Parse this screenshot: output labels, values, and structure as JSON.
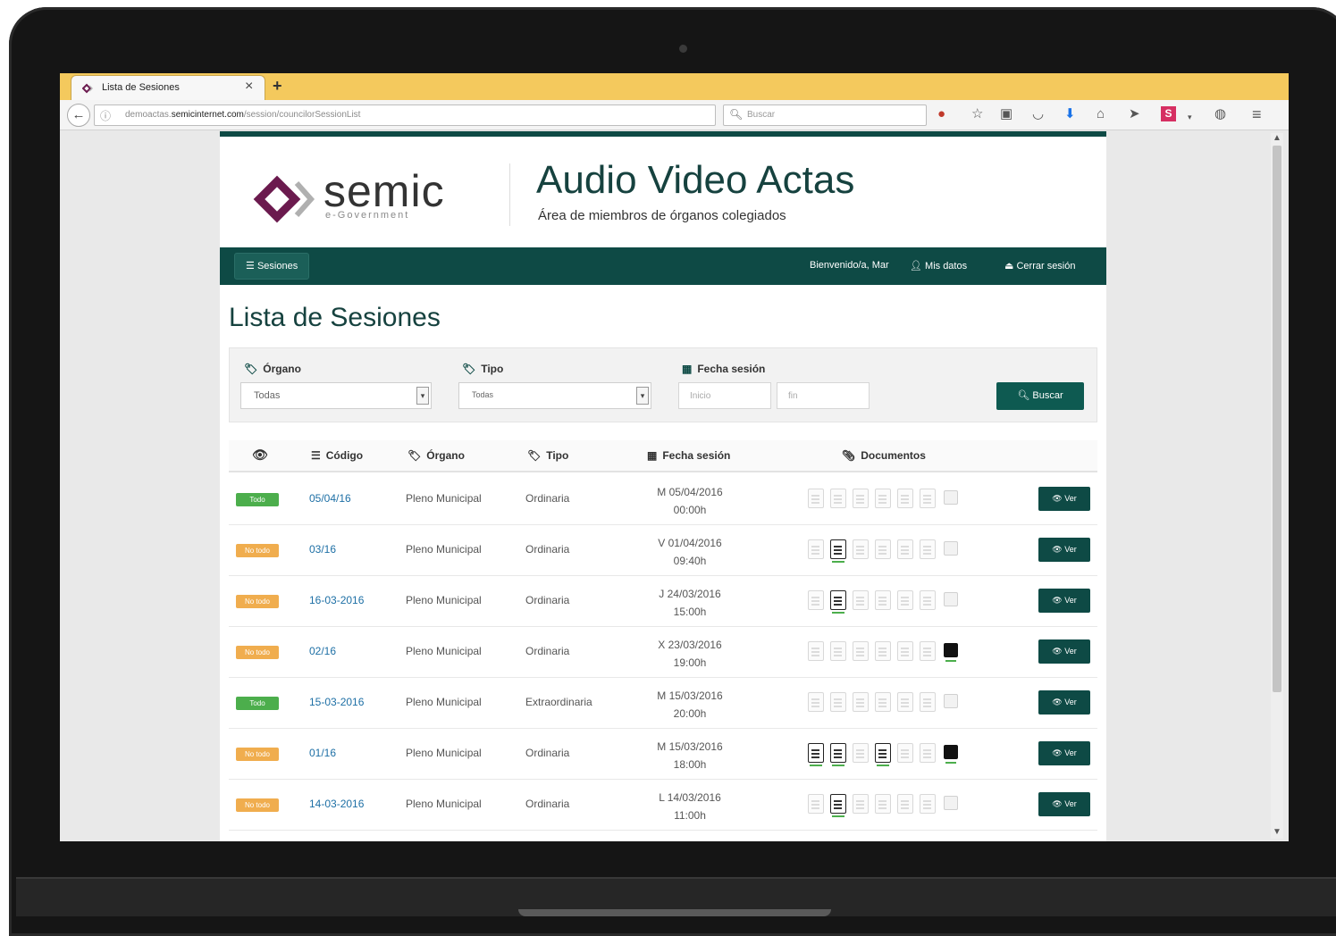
{
  "browser": {
    "tab_title": "Lista de Sesiones",
    "new_tab": "+",
    "url_prefix": "demoactas.",
    "url_domain": "semicinternet.com",
    "url_path": "/session/councilorSessionList",
    "search_placeholder": "Buscar"
  },
  "header": {
    "logo_text": "semic",
    "logo_sub": "e-Government",
    "app_title": "Audio Video Actas",
    "app_subtitle": "Área de miembros de órganos colegiados"
  },
  "nav": {
    "sesiones": "Sesiones",
    "welcome": "Bienvenido/a, Mar",
    "mis_datos": "Mis datos",
    "cerrar_sesion": "Cerrar sesión"
  },
  "page_title": "Lista de Sesiones",
  "filters": {
    "organo_label": "Órgano",
    "organo_value": "Todas",
    "tipo_label": "Tipo",
    "tipo_value": "Todas",
    "fecha_label": "Fecha sesión",
    "inicio_placeholder": "Inicio",
    "fin_placeholder": "fin",
    "buscar_label": "Buscar"
  },
  "table": {
    "headers": {
      "codigo": "Código",
      "organo": "Órgano",
      "tipo": "Tipo",
      "fecha": "Fecha sesión",
      "documentos": "Documentos"
    },
    "ver_label": "Ver",
    "rows": [
      {
        "status": "Todo",
        "status_color": "#4cae4c",
        "code": "05/04/16",
        "organo": "Pleno Municipal",
        "tipo": "Ordinaria",
        "date": "M 05/04/2016",
        "time": "00:00h",
        "docs": [
          0,
          0,
          0,
          0,
          0,
          0
        ],
        "video": 0
      },
      {
        "status": "No todo",
        "status_color": "#f0ad4e",
        "code": "03/16",
        "organo": "Pleno Municipal",
        "tipo": "Ordinaria",
        "date": "V 01/04/2016",
        "time": "09:40h",
        "docs": [
          0,
          1,
          0,
          0,
          0,
          0
        ],
        "video": 0
      },
      {
        "status": "No todo",
        "status_color": "#f0ad4e",
        "code": "16-03-2016",
        "organo": "Pleno Municipal",
        "tipo": "Ordinaria",
        "date": "J 24/03/2016",
        "time": "15:00h",
        "docs": [
          0,
          1,
          0,
          0,
          0,
          0
        ],
        "video": 0
      },
      {
        "status": "No todo",
        "status_color": "#f0ad4e",
        "code": "02/16",
        "organo": "Pleno Municipal",
        "tipo": "Ordinaria",
        "date": "X 23/03/2016",
        "time": "19:00h",
        "docs": [
          0,
          0,
          0,
          0,
          0,
          0
        ],
        "video": 1
      },
      {
        "status": "Todo",
        "status_color": "#4cae4c",
        "code": "15-03-2016",
        "organo": "Pleno Municipal",
        "tipo": "Extraordinaria",
        "date": "M 15/03/2016",
        "time": "20:00h",
        "docs": [
          0,
          0,
          0,
          0,
          0,
          0
        ],
        "video": 0
      },
      {
        "status": "No todo",
        "status_color": "#f0ad4e",
        "code": "01/16",
        "organo": "Pleno Municipal",
        "tipo": "Ordinaria",
        "date": "M 15/03/2016",
        "time": "18:00h",
        "docs": [
          1,
          1,
          0,
          1,
          0,
          0
        ],
        "video": 1
      },
      {
        "status": "No todo",
        "status_color": "#f0ad4e",
        "code": "14-03-2016",
        "organo": "Pleno Municipal",
        "tipo": "Ordinaria",
        "date": "L 14/03/2016",
        "time": "11:00h",
        "docs": [
          0,
          1,
          0,
          0,
          0,
          0
        ],
        "video": 0
      }
    ]
  },
  "colors": {
    "brand_dark": "#0e4a45",
    "logo_purple": "#6b1a4e",
    "tab_bar": "#f4c95d"
  }
}
